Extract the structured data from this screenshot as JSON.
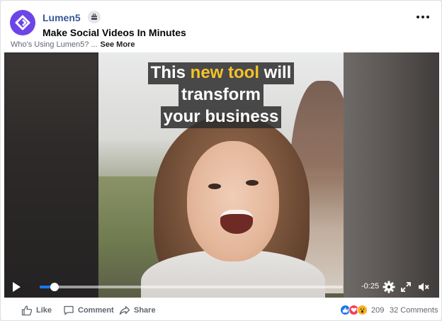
{
  "post": {
    "page_name": "Lumen5",
    "title": "Make Social Videos In Minutes",
    "description": "Who's Using Lumen5? ...",
    "see_more": "See More",
    "page_badge_icon": "briefcase-icon",
    "menu_icon": "more-horizontal-icon"
  },
  "video": {
    "overlay_lines": [
      {
        "pre": "This ",
        "highlight": "new tool",
        "post": " will"
      },
      {
        "pre": "transform",
        "highlight": "",
        "post": ""
      },
      {
        "pre": "your business",
        "highlight": "",
        "post": ""
      }
    ],
    "highlight_color": "#f5c22b",
    "progress": 0.05,
    "time_remaining": "-0:25",
    "controls": [
      "play-icon",
      "settings-icon",
      "fullscreen-icon",
      "mute-icon"
    ]
  },
  "footer": {
    "like_label": "Like",
    "comment_label": "Comment",
    "share_label": "Share",
    "reaction_icons": [
      "like-reaction-icon",
      "love-reaction-icon",
      "wow-reaction-icon"
    ],
    "reaction_count": "209",
    "comments_label": "32 Comments"
  },
  "colors": {
    "brand": "#6b45e6",
    "page_link": "#385898",
    "progress": "#1877f2"
  }
}
